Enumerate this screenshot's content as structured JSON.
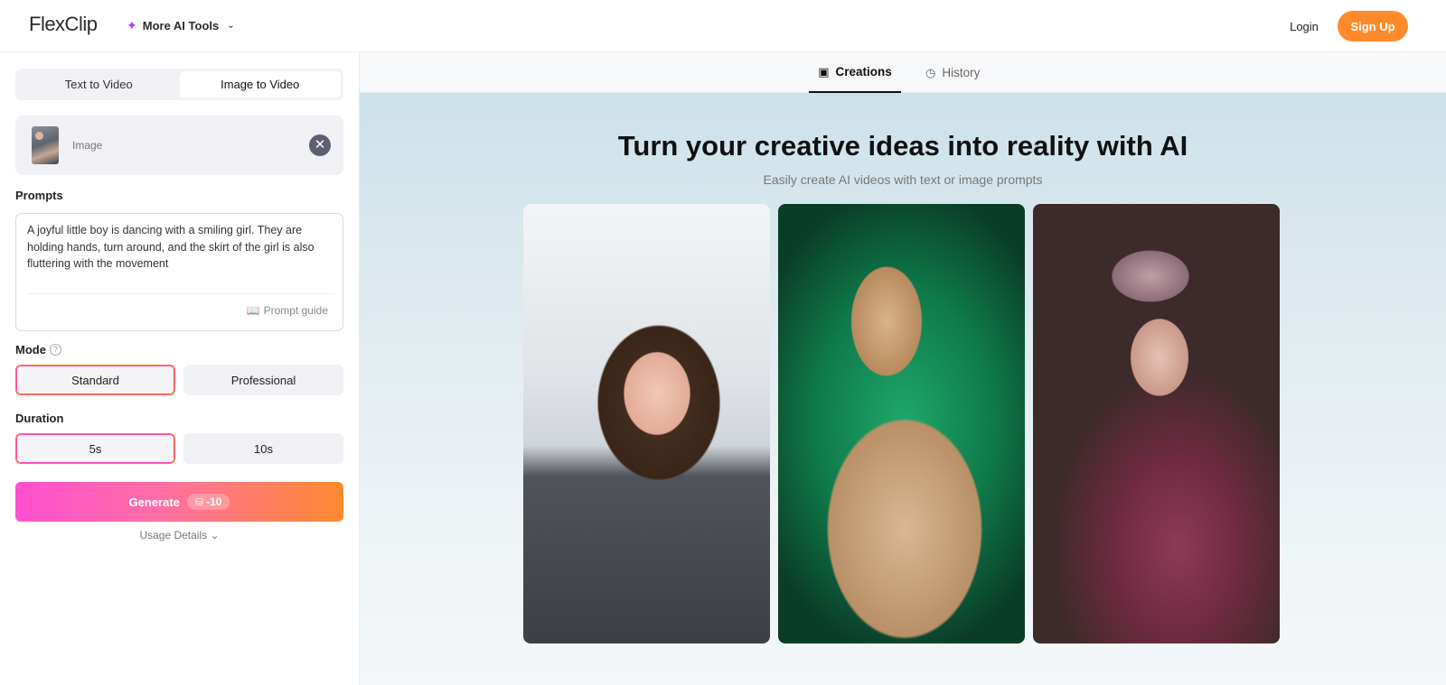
{
  "header": {
    "logo": "FlexClip",
    "more_tools_label": "More AI Tools",
    "login_label": "Login",
    "signup_label": "Sign Up"
  },
  "left_panel": {
    "mode_tabs": [
      "Text to Video",
      "Image to Video"
    ],
    "active_mode_tab": "Image to Video",
    "image_label": "Image",
    "prompts_label": "Prompts",
    "prompt_text": "A joyful little boy is dancing with a smiling girl. They are holding hands, turn around, and the skirt of the girl is also fluttering with the movement",
    "prompt_guide_label": "Prompt guide",
    "mode_label": "Mode",
    "mode_options": [
      "Standard",
      "Professional"
    ],
    "mode_selected": "Standard",
    "duration_label": "Duration",
    "duration_options": [
      "5s",
      "10s"
    ],
    "duration_selected": "5s",
    "generate_label": "Generate",
    "generate_cost": "-10",
    "usage_details_label": "Usage Details"
  },
  "right_panel": {
    "tabs": [
      "Creations",
      "History"
    ],
    "active_tab": "Creations",
    "title": "Turn your creative ideas into reality with AI",
    "subtitle": "Easily create AI videos with text or image prompts"
  },
  "colors": {
    "accent_orange": "#ff8a2b",
    "generate_gradient_start": "#ff4fd1",
    "generate_gradient_end": "#ff8a30",
    "selected_border": "#ff7a1a"
  }
}
